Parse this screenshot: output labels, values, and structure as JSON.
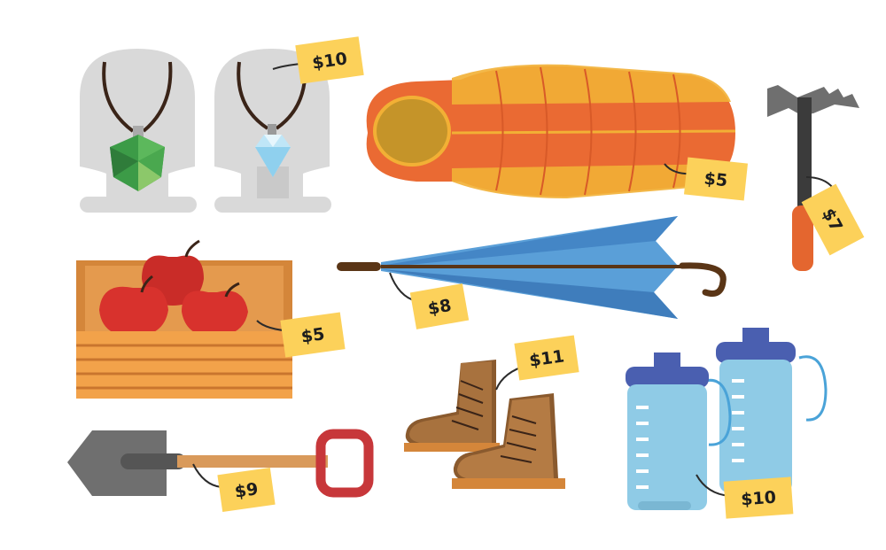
{
  "items": [
    {
      "id": "necklace-green",
      "price": "$10"
    },
    {
      "id": "sleeping-bag",
      "price": "$5"
    },
    {
      "id": "ice-axe",
      "price": "$7"
    },
    {
      "id": "apple-crate",
      "price": "$5"
    },
    {
      "id": "umbrella",
      "price": "$8"
    },
    {
      "id": "shovel",
      "price": "$9"
    },
    {
      "id": "hiking-boots",
      "price": "$11"
    },
    {
      "id": "water-bottles",
      "price": "$10"
    }
  ],
  "colors": {
    "tag": "#fcd15a",
    "string": "#2b2b2b",
    "bust": "#d9d9d9",
    "sleeping_bag": "#ea6a33",
    "sleeping_bag_accent": "#f2b035",
    "umbrella": "#5a9fd8",
    "apple": "#d8322d",
    "crate": "#f2a24a",
    "boots": "#a8723e",
    "bottle": "#8fcbe6",
    "bottle_cap": "#4a5fb0",
    "shovel_blade": "#6f6f6f",
    "shovel_handle": "#d99a5b",
    "shovel_grip": "#c7373a"
  }
}
